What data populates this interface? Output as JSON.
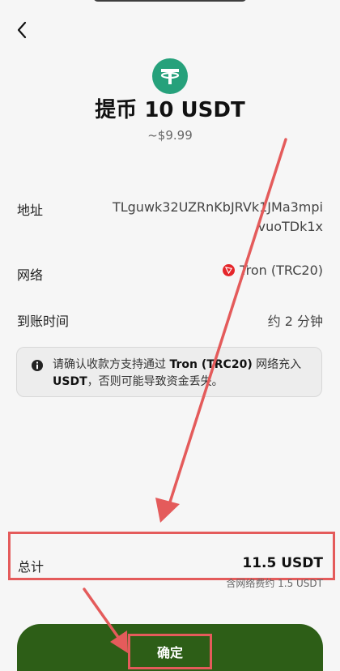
{
  "header": {
    "back_icon": "chevron-left-icon",
    "token_icon": "tether-icon",
    "title": "提币 10 USDT",
    "fiat_value": "~$9.99"
  },
  "details": {
    "address_label": "地址",
    "address_line1": "TLguwk32UZRnKbJRVk1JMa3mpi",
    "address_line2": "vuoTDk1x",
    "network_label": "网络",
    "network_value": "Tron (TRC20)",
    "network_icon": "tron-icon",
    "arrival_label": "到账时间",
    "arrival_value": "约 2 分钟"
  },
  "notice": {
    "icon": "info-icon",
    "part1": "请确认收款方支持通过 ",
    "network_bold": "Tron (TRC20)",
    "part2": " 网络充入 ",
    "token_bold": "USDT",
    "part3": "，否则可能导致资金丢失。"
  },
  "total": {
    "label": "总计",
    "amount": "11.5 USDT",
    "fee_note": "含网络费约 1.5 USDT"
  },
  "actions": {
    "confirm_label": "确定"
  },
  "colors": {
    "accent_green": "#2d5e17",
    "tether_green": "#26a17b",
    "tron_red": "#e5262a",
    "annotation_red": "#e45b5b"
  }
}
